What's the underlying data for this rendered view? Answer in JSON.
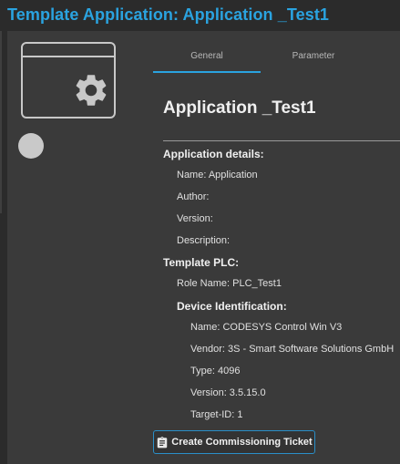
{
  "window": {
    "title": "Template Application: Application _Test1"
  },
  "tabs": [
    {
      "label": "General",
      "active": true
    },
    {
      "label": "Parameter",
      "active": false
    }
  ],
  "icons": {
    "card": "gear-icon",
    "status": "status-indicator",
    "button": "clipboard-icon"
  },
  "colors": {
    "accent": "#2aa3e0",
    "background": "#2b2b2b",
    "panel": "#3a3a3a"
  },
  "main": {
    "app_title": "Application _Test1",
    "details_header": "Application details:",
    "name": "Name: Application",
    "author": "Author:",
    "version": "Version:",
    "description": "Description:",
    "plc_header": "Template PLC:",
    "role_name": "Role Name: PLC_Test1",
    "device_header": "Device Identification:",
    "device_name": "Name: CODESYS Control Win V3",
    "device_vendor": "Vendor: 3S - Smart Software Solutions GmbH",
    "device_type": "Type: 4096",
    "device_version": "Version: 3.5.15.0",
    "target_id": "Target-ID: 1"
  },
  "actions": {
    "create_ticket": "Create Commissioning Ticket"
  }
}
